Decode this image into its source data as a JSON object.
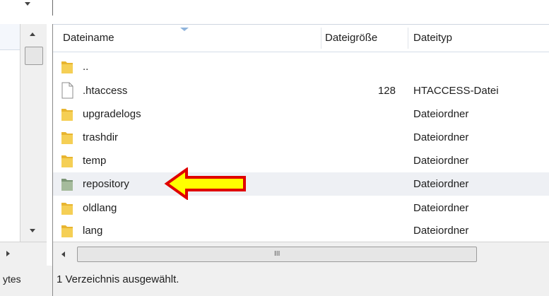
{
  "left_pane": {
    "status_text": "ytes"
  },
  "file_list": {
    "columns": {
      "name": "Dateiname",
      "size": "Dateigröße",
      "type": "Dateityp"
    },
    "rows": [
      {
        "name": "..",
        "size": "",
        "type": "",
        "icon": "folder-icon"
      },
      {
        "name": ".htaccess",
        "size": "128",
        "type": "HTACCESS-Datei",
        "icon": "file-icon"
      },
      {
        "name": "upgradelogs",
        "size": "",
        "type": "Dateiordner",
        "icon": "folder-icon"
      },
      {
        "name": "trashdir",
        "size": "",
        "type": "Dateiordner",
        "icon": "folder-icon"
      },
      {
        "name": "temp",
        "size": "",
        "type": "Dateiordner",
        "icon": "folder-icon"
      },
      {
        "name": "repository",
        "size": "",
        "type": "Dateiordner",
        "icon": "repository-folder-icon"
      },
      {
        "name": "oldlang",
        "size": "",
        "type": "Dateiordner",
        "icon": "folder-icon"
      },
      {
        "name": "lang",
        "size": "",
        "type": "Dateiordner",
        "icon": "folder-icon"
      }
    ]
  },
  "hscroll": {
    "grip": "III"
  },
  "status_bar": {
    "text": "1 Verzeichnis ausgewählt."
  },
  "colors": {
    "folder": "#e8b530",
    "folder_repository": "#8fa886",
    "selection": "#eef0f4",
    "arrow_fill": "#ffff00",
    "arrow_stroke": "#e00000"
  }
}
